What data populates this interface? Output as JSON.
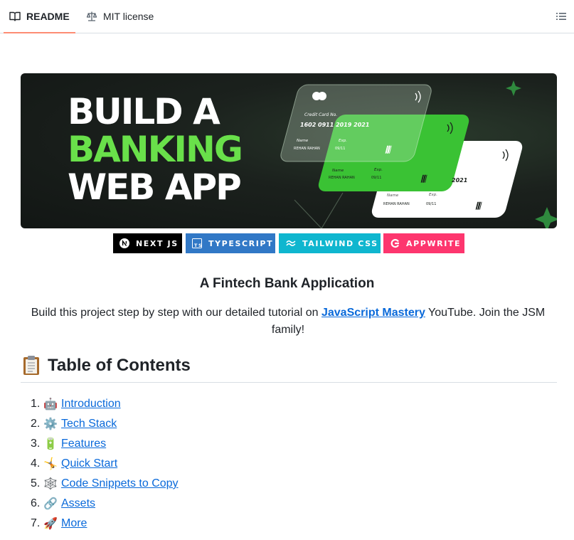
{
  "tabs": [
    {
      "label": "README",
      "icon": "book-icon",
      "active": true
    },
    {
      "label": "MIT license",
      "icon": "scale-icon",
      "active": false
    }
  ],
  "toolbar": {
    "outline_icon": "list-unordered-icon"
  },
  "banner": {
    "line1": "BUILD A",
    "line2": "BANKING",
    "line3": "WEB APP",
    "card1": {
      "label": "Credit Card No.",
      "number": [
        "1602",
        "0911",
        "2019",
        "2021"
      ],
      "name_label": "Name",
      "name": "REHAN RAHAN",
      "exp_label": "Exp.",
      "exp": "09/11"
    },
    "card2": {
      "name_label": "Name",
      "name": "REHAN RAHAN",
      "exp_label": "Exp.",
      "exp": "09/11"
    },
    "card3": {
      "number_tail": "2021",
      "name_label": "Name",
      "name": "REHAN RAHAN",
      "exp_label": "Exp.",
      "exp": "09/11"
    },
    "colors": {
      "accent": "#69e04a",
      "bg": "#1b211d"
    }
  },
  "badges": [
    {
      "label": "NEXT JS",
      "color": "#000000",
      "icon": "nextjs-icon"
    },
    {
      "label": "TYPESCRIPT",
      "color": "#3178c6",
      "icon": "typescript-icon"
    },
    {
      "label": "TAILWIND CSS",
      "color": "#0fb6cf",
      "icon": "tailwind-icon"
    },
    {
      "label": "APPWRITE",
      "color": "#fd366e",
      "icon": "appwrite-icon"
    }
  ],
  "subtitle": "A Fintech Bank Application",
  "description": {
    "before": "Build this project step by step with our detailed tutorial on ",
    "link": "JavaScript Mastery",
    "after": " YouTube. Join the JSM family!"
  },
  "toc": {
    "heading": "Table of Contents",
    "heading_icon": "clipboard-icon",
    "items": [
      {
        "num": "1.",
        "emoji": "robot-icon",
        "glyph": "🤖",
        "label": "Introduction"
      },
      {
        "num": "2.",
        "emoji": "gear-icon",
        "glyph": "⚙️",
        "label": "Tech Stack"
      },
      {
        "num": "3.",
        "emoji": "battery-icon",
        "glyph": "🔋",
        "label": "Features"
      },
      {
        "num": "4.",
        "emoji": "cartwheel-icon",
        "glyph": "🤸",
        "label": "Quick Start"
      },
      {
        "num": "5.",
        "emoji": "spider-web-icon",
        "glyph": "🕸️",
        "label": "Code Snippets to Copy"
      },
      {
        "num": "6.",
        "emoji": "link-icon",
        "glyph": "🔗",
        "label": "Assets"
      },
      {
        "num": "7.",
        "emoji": "rocket-icon",
        "glyph": "🚀",
        "label": "More"
      }
    ]
  }
}
